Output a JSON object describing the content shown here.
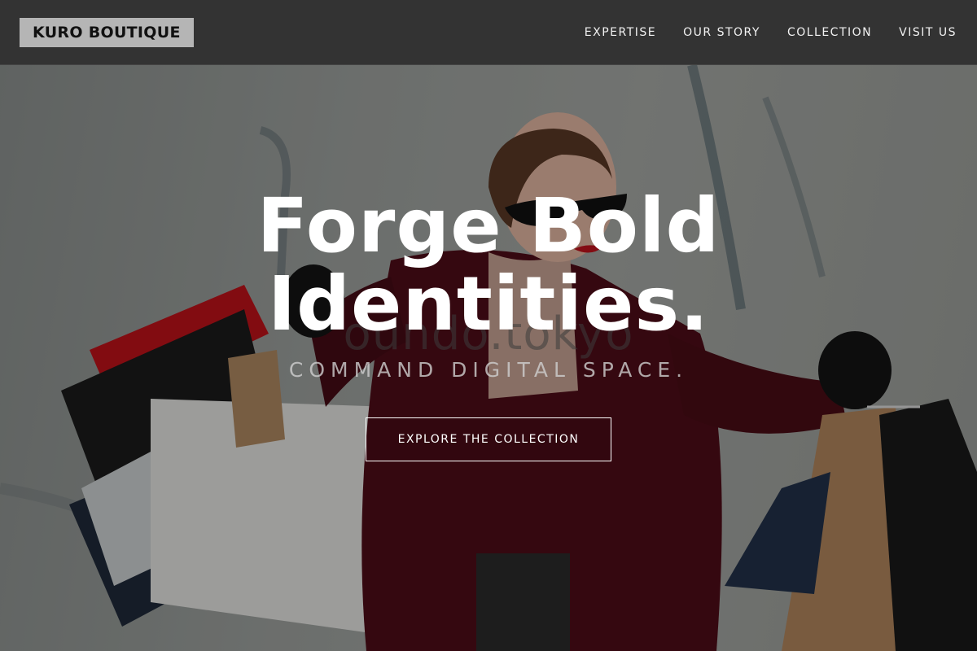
{
  "brand": {
    "name": "KURO BOUTIQUE"
  },
  "nav": {
    "items": [
      {
        "label": "EXPERTISE"
      },
      {
        "label": "OUR STORY"
      },
      {
        "label": "COLLECTION"
      },
      {
        "label": "VISIT US"
      }
    ]
  },
  "hero": {
    "title_line1": "Forge Bold",
    "title_line2": "Identities.",
    "subtitle": "COMMAND DIGITAL SPACE.",
    "cta_label": "EXPLORE THE COLLECTION",
    "watermark": "oundo.tokyo"
  },
  "colors": {
    "navbar_bg": "#333333",
    "brand_bg": "#b5b5b5",
    "text_light": "#ffffff",
    "coat_red": "#5a1020"
  }
}
